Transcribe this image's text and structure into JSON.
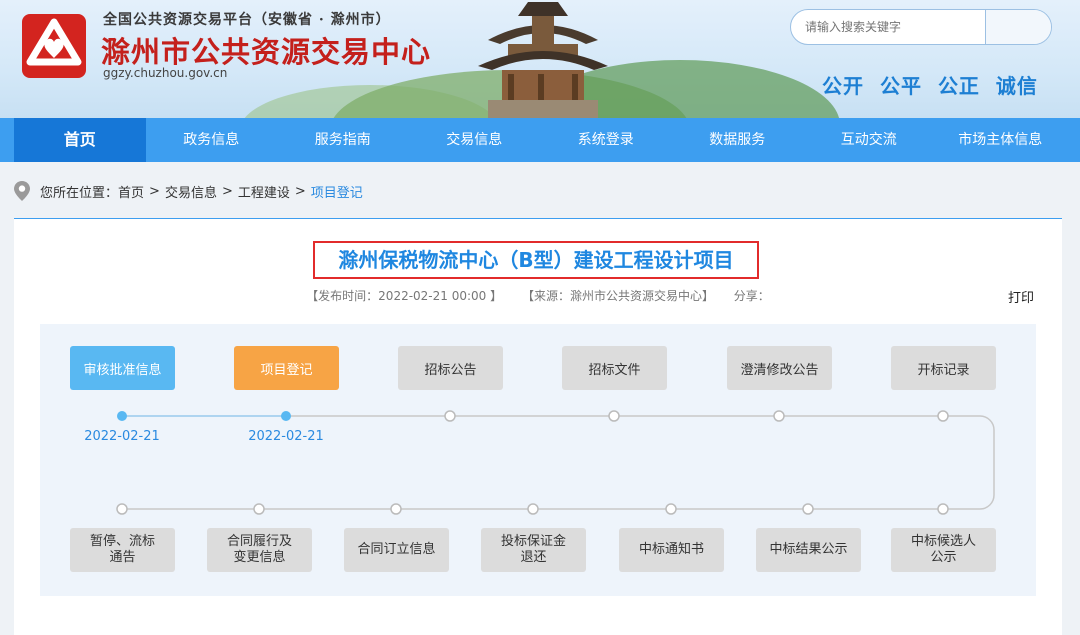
{
  "header": {
    "platform": "全国公共资源交易平台（安徽省 · 滁州市）",
    "title": "滁州市公共资源交易中心",
    "url": "ggzy.chuzhou.gov.cn",
    "search_placeholder": "请输入搜索关键字",
    "slogans": [
      "公开",
      "公平",
      "公正",
      "诚信"
    ]
  },
  "nav": {
    "items": [
      "首页",
      "政务信息",
      "服务指南",
      "交易信息",
      "系统登录",
      "数据服务",
      "互动交流",
      "市场主体信息"
    ]
  },
  "breadcrumb": {
    "prefix": "您所在位置：",
    "items": [
      "首页",
      "交易信息",
      "工程建设",
      "项目登记"
    ]
  },
  "article": {
    "title": "滁州保税物流中心（B型）建设工程设计项目",
    "publish_time": "【发布时间：2022-02-21 00:00 】",
    "source": "【来源：滁州市公共资源交易中心】",
    "share": "分享：",
    "print": "打印"
  },
  "flow": {
    "top_steps": [
      {
        "label": "审核批准信息",
        "state": "done"
      },
      {
        "label": "项目登记",
        "state": "current"
      },
      {
        "label": "招标公告",
        "state": "pending"
      },
      {
        "label": "招标文件",
        "state": "pending"
      },
      {
        "label": "澄清修改公告",
        "state": "pending"
      },
      {
        "label": "开标记录",
        "state": "pending"
      }
    ],
    "dates": [
      "2022-02-21",
      "2022-02-21"
    ],
    "bottom_steps": [
      {
        "label": "暂停、流标\n通告"
      },
      {
        "label": "合同履行及\n变更信息"
      },
      {
        "label": "合同订立信息"
      },
      {
        "label": "投标保证金\n退还"
      },
      {
        "label": "中标通知书"
      },
      {
        "label": "中标结果公示"
      },
      {
        "label": "中标候选人\n公示"
      }
    ],
    "colors": {
      "done": "#59b8f2",
      "current": "#f7a445",
      "pending": "#dcdcdc"
    }
  }
}
